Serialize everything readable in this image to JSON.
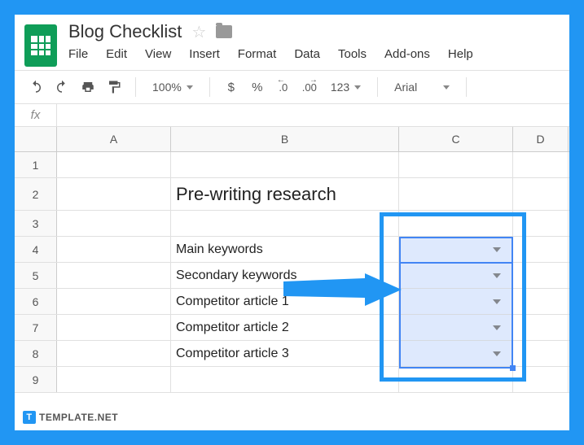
{
  "doc": {
    "title": "Blog Checklist"
  },
  "menu": {
    "file": "File",
    "edit": "Edit",
    "view": "View",
    "insert": "Insert",
    "format": "Format",
    "data": "Data",
    "tools": "Tools",
    "addons": "Add-ons",
    "help": "Help"
  },
  "toolbar": {
    "zoom": "100%",
    "dollar": "$",
    "percent": "%",
    "dec_dec": ".0",
    "dec_inc": ".00",
    "numfmt": "123",
    "font": "Arial"
  },
  "columns": {
    "A": "A",
    "B": "B",
    "C": "C",
    "D": "D"
  },
  "rows": {
    "r1": "1",
    "r2": "2",
    "r3": "3",
    "r4": "4",
    "r5": "5",
    "r6": "6",
    "r7": "7",
    "r8": "8",
    "r9": "9"
  },
  "cells": {
    "B2": "Pre-writing research",
    "B4": "Main keywords",
    "B5": "Secondary keywords",
    "B6": "Competitor article 1",
    "B7": "Competitor article 2",
    "B8": "Competitor article 3"
  },
  "watermark": {
    "text": "TEMPLATE.NET",
    "logo": "T"
  }
}
